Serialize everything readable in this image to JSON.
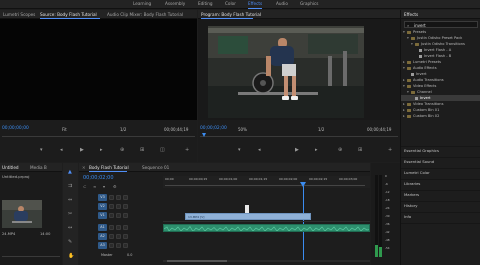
{
  "workspace_tabs": [
    "Learning",
    "Assembly",
    "Editing",
    "Color",
    "Effects",
    "Audio",
    "Graphics"
  ],
  "workspace_active": "Effects",
  "left_panel": {
    "tabs": [
      "Lumetri Scopes",
      "Source: Body Flash Tutorial",
      "Audio Clip Mixer: Body Flash Tutorial"
    ],
    "timecode": "00;00;00;00",
    "fit_label": "Fit",
    "fraction": "1/2",
    "duration": "00;00;44;19"
  },
  "program": {
    "title": "Program: Body Flash Tutorial",
    "timecode": "00;00;02;00",
    "zoom": "50%",
    "fraction": "1/2",
    "duration": "00;00;44;19"
  },
  "project_panel": {
    "title": "Untitled",
    "tab2": "Media B",
    "file": "Untitled.prproj",
    "clip_name": "24.MP4",
    "clip_duration": "14:00"
  },
  "timeline": {
    "tab": "Body Flash Tutorial",
    "tab2": "Sequence 01",
    "timecode": "00;00;02;00",
    "ruler": [
      "00;00",
      "00;00;00;15",
      "00;00;01;00",
      "00;00;01;15",
      "00;00;02;00",
      "00;00;02;15",
      "00;00;03;00"
    ],
    "video_tracks": [
      "V3",
      "V2",
      "V1"
    ],
    "audio_tracks": [
      "A1",
      "A2",
      "A3"
    ],
    "master": "Master",
    "master_value": "0.0",
    "clip_label": "13.MP4 [V]"
  },
  "effects": {
    "header": "Effects",
    "search_value": "invert",
    "items": [
      {
        "label": "Presets",
        "indent": 1,
        "kind": "folder"
      },
      {
        "label": "Justin Odisho Preset Pack",
        "indent": 2,
        "kind": "folder"
      },
      {
        "label": "Justin Odisho Transitions",
        "indent": 3,
        "kind": "folder"
      },
      {
        "label": "Invert Flash - A",
        "indent": 4,
        "kind": "fx"
      },
      {
        "label": "Invert Flash - B",
        "indent": 4,
        "kind": "fx"
      },
      {
        "label": "Lumetri Presets",
        "indent": 1,
        "kind": "folder"
      },
      {
        "label": "Audio Effects",
        "indent": 1,
        "kind": "folder"
      },
      {
        "label": "Invert",
        "indent": 2,
        "kind": "fx"
      },
      {
        "label": "Audio Transitions",
        "indent": 1,
        "kind": "folder"
      },
      {
        "label": "Video Effects",
        "indent": 1,
        "kind": "folder"
      },
      {
        "label": "Channel",
        "indent": 2,
        "kind": "folder"
      },
      {
        "label": "Invert",
        "indent": 3,
        "kind": "fx",
        "selected": true
      },
      {
        "label": "Video Transitions",
        "indent": 1,
        "kind": "folder"
      },
      {
        "label": "Custom Bin 01",
        "indent": 1,
        "kind": "folder"
      },
      {
        "label": "Custom Bin 02",
        "indent": 1,
        "kind": "folder"
      }
    ],
    "sections": [
      "Essential Graphics",
      "Essential Sound",
      "Lumetri Color",
      "Libraries",
      "Markers",
      "History",
      "Info"
    ]
  },
  "meter_labels": [
    "0",
    "-6",
    "-12",
    "-18",
    "-24",
    "-30",
    "-36",
    "-42",
    "-48",
    "-54"
  ]
}
